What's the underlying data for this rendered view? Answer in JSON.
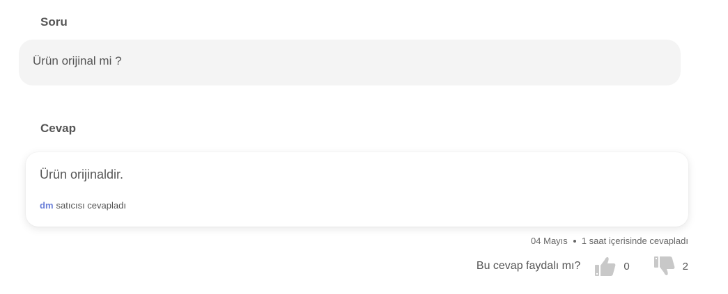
{
  "question": {
    "heading": "Soru",
    "text": "Ürün orijinal mi ?"
  },
  "answer": {
    "heading": "Cevap",
    "text": "Ürün orijinaldir.",
    "seller_name": "dm",
    "seller_suffix": "satıcısı cevapladı",
    "date": "04 Mayıs",
    "response_time": "1 saat içerisinde cevapladı"
  },
  "feedback": {
    "question": "Bu cevap faydalı mı?",
    "upvote_icon": "thumbs-up-icon",
    "upvote_count": "0",
    "downvote_icon": "thumbs-down-icon",
    "downvote_count": "2",
    "icon_color": "#c8c8c8"
  },
  "colors": {
    "text": "#555555",
    "seller_accent": "#6a7fd8",
    "question_bg": "#f4f4f4"
  }
}
